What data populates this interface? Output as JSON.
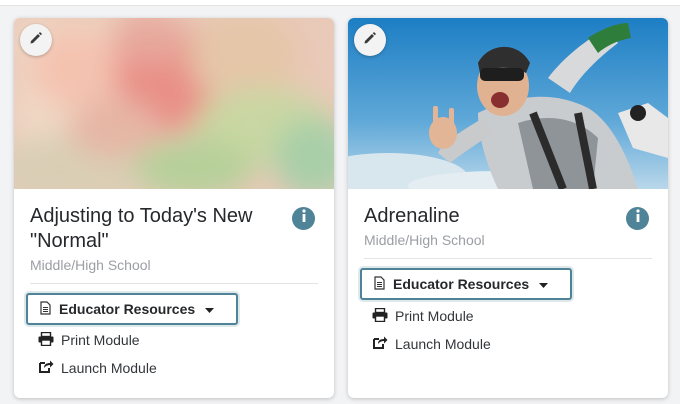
{
  "cards": [
    {
      "title": "Adjusting to Today's New \"Normal\"",
      "grade": "Middle/High School",
      "educator_label": "Educator Resources",
      "print_label": "Print Module",
      "launch_label": "Launch Module"
    },
    {
      "title": "Adrenaline",
      "grade": "Middle/High School",
      "educator_label": "Educator Resources",
      "print_label": "Print Module",
      "launch_label": "Launch Module"
    }
  ],
  "colors": {
    "accent": "#4f8398",
    "title_text": "#26282b",
    "muted_text": "#9b9ea3"
  },
  "icons": {
    "edit": "pencil-icon",
    "info": "info-icon",
    "document": "document-icon",
    "caret": "caret-down-icon",
    "print": "printer-icon",
    "launch": "share-external-icon"
  }
}
